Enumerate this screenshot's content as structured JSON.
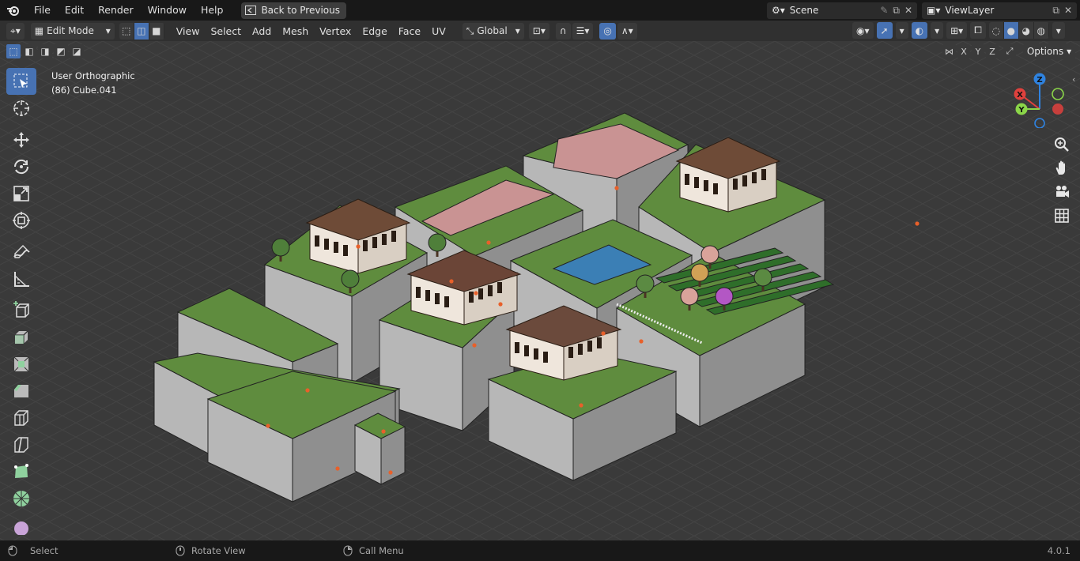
{
  "menubar": {
    "items": [
      "File",
      "Edit",
      "Render",
      "Window",
      "Help"
    ],
    "back_button": "Back to Previous",
    "scene_label": "Scene",
    "viewlayer_label": "ViewLayer"
  },
  "header": {
    "mode": "Edit Mode",
    "menus": [
      "View",
      "Select",
      "Add",
      "Mesh",
      "Vertex",
      "Edge",
      "Face",
      "UV"
    ],
    "transform_orientation": "Global",
    "options_label": "Options",
    "axis_buttons": [
      "X",
      "Y",
      "Z"
    ]
  },
  "viewport": {
    "view_name": "User Orthographic",
    "object_info": "(86) Cube.041"
  },
  "gizmo": {
    "x_label": "X",
    "y_label": "Y",
    "z_label": "Z",
    "colors": {
      "x": "#e0413d",
      "y": "#8bd649",
      "z": "#2f83e0"
    }
  },
  "toolbar": {
    "tools": [
      "select-box",
      "cursor",
      "move",
      "rotate",
      "scale",
      "transform",
      "annotate",
      "measure",
      "add-cube",
      "extrude",
      "inset",
      "bevel",
      "loop-cut",
      "knife",
      "poly-build",
      "spin",
      "smooth"
    ]
  },
  "statusbar": {
    "select": "Select",
    "rotate_view": "Rotate View",
    "call_menu": "Call Menu",
    "version": "4.0.1"
  },
  "colors": {
    "accent": "#4772b3",
    "grass": "#5f8c3e",
    "pavement": "#c99393",
    "water": "#3b7fb5",
    "block": "#9d9d9d"
  }
}
